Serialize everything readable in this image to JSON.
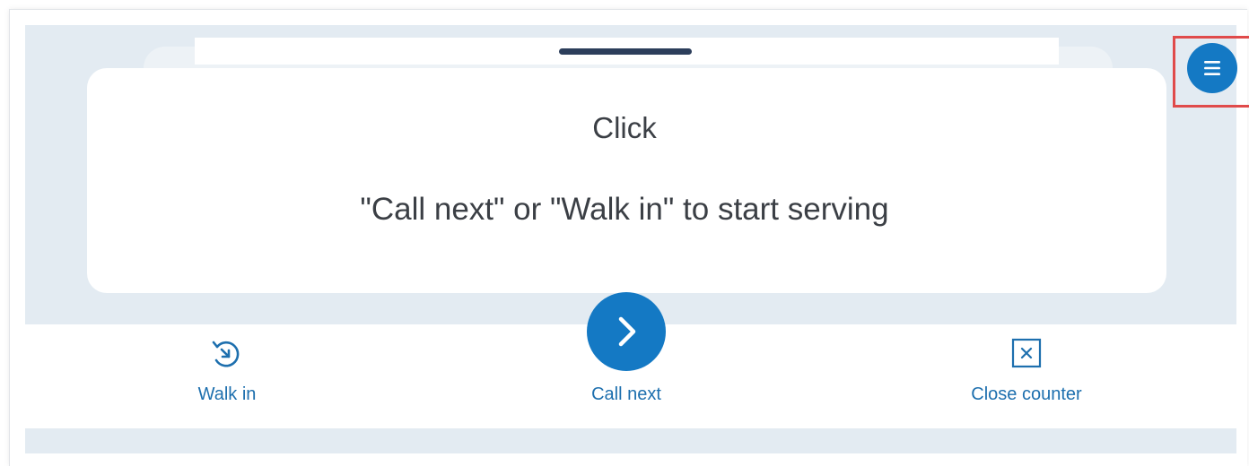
{
  "card": {
    "title": "Click",
    "subtitle": "\"Call next\" or \"Walk in\" to start serving"
  },
  "actions": {
    "walk_in_label": "Walk in",
    "call_next_label": "Call next",
    "close_counter_label": "Close counter"
  },
  "icons": {
    "menu": "hamburger-menu-icon",
    "call_next": "chevron-right-icon",
    "walk_in": "walk-in-clock-icon",
    "close_counter": "close-x-box-icon"
  },
  "colors": {
    "accent": "#1479c4",
    "label": "#1d6fae",
    "band": "#e3ebf2",
    "highlight": "#e04b4b"
  }
}
